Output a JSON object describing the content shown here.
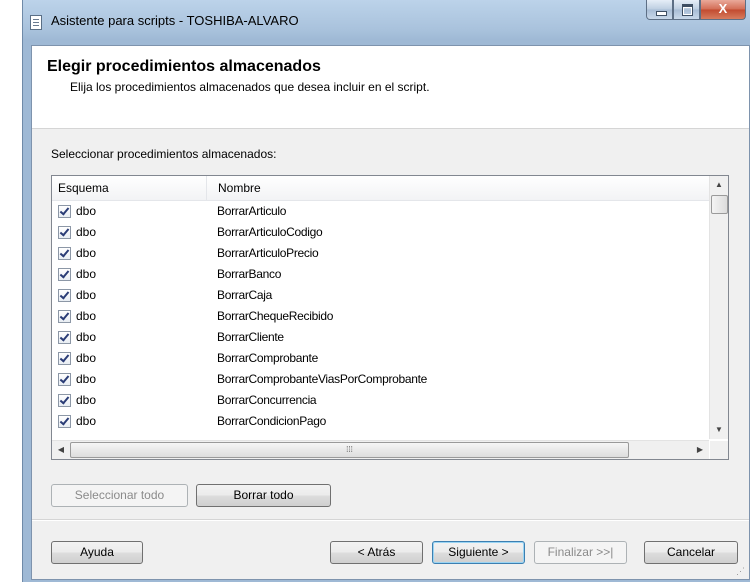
{
  "window": {
    "title": "Asistente para scripts - TOSHIBA-ALVARO",
    "close_glyph": "X"
  },
  "header": {
    "title": "Elegir procedimientos almacenados",
    "subtitle": "Elija los procedimientos almacenados que desea incluir en el script."
  },
  "list": {
    "label": "Seleccionar procedimientos almacenados:",
    "columns": [
      "Esquema",
      "Nombre"
    ],
    "rows": [
      {
        "checked": true,
        "schema": "dbo",
        "name": "BorrarArticulo"
      },
      {
        "checked": true,
        "schema": "dbo",
        "name": "BorrarArticuloCodigo"
      },
      {
        "checked": true,
        "schema": "dbo",
        "name": "BorrarArticuloPrecio"
      },
      {
        "checked": true,
        "schema": "dbo",
        "name": "BorrarBanco"
      },
      {
        "checked": true,
        "schema": "dbo",
        "name": "BorrarCaja"
      },
      {
        "checked": true,
        "schema": "dbo",
        "name": "BorrarChequeRecibido"
      },
      {
        "checked": true,
        "schema": "dbo",
        "name": "BorrarCliente"
      },
      {
        "checked": true,
        "schema": "dbo",
        "name": "BorrarComprobante"
      },
      {
        "checked": true,
        "schema": "dbo",
        "name": "BorrarComprobanteViasPorComprobante"
      },
      {
        "checked": true,
        "schema": "dbo",
        "name": "BorrarConcurrencia"
      },
      {
        "checked": true,
        "schema": "dbo",
        "name": "BorrarCondicionPago"
      }
    ]
  },
  "selection_buttons": {
    "select_all": "Seleccionar todo",
    "clear_all": "Borrar todo"
  },
  "footer_buttons": {
    "help": "Ayuda",
    "back": "< Atrás",
    "next": "Siguiente >",
    "finish": "Finalizar >>|",
    "cancel": "Cancelar"
  }
}
